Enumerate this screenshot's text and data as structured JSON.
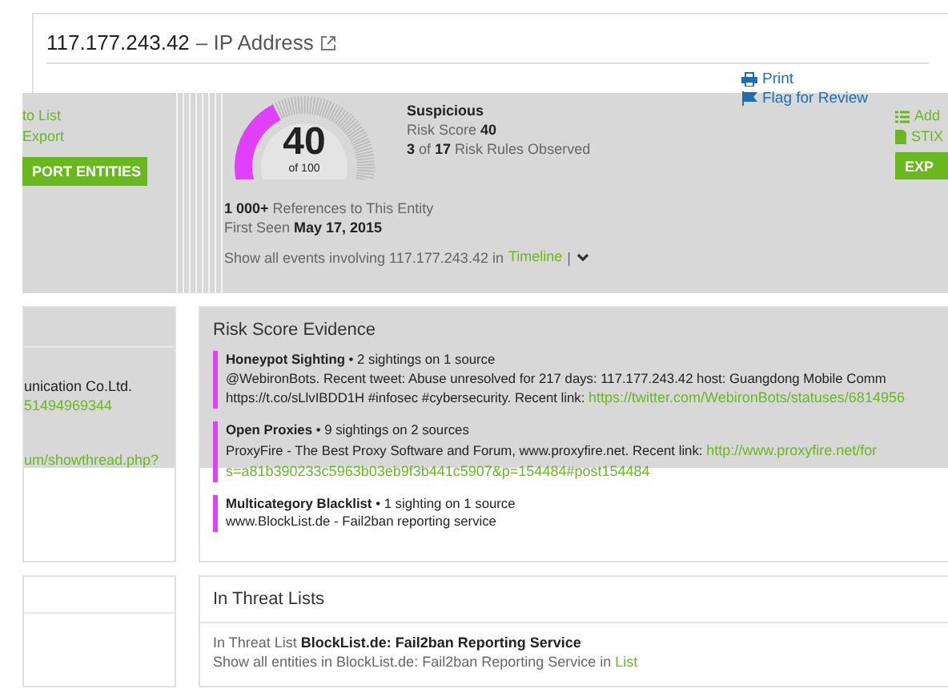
{
  "header": {
    "title": "117.177.243.42",
    "subtitle": "– IP Address",
    "actions": [
      {
        "label": "Print",
        "kind": "print"
      },
      {
        "label": "Flag for Review",
        "kind": "flag"
      }
    ]
  },
  "summary": {
    "left_links": [
      "to List",
      "Export"
    ],
    "left_button": "PORT ENTITIES",
    "gauge": {
      "score": "40",
      "of": "of 100"
    },
    "verdict": "Suspicious",
    "risk": "Risk Score **40**",
    "rules": "**3** of **17** Risk Rules Observed",
    "right_links": [
      {
        "label": "Add",
        "kind": "list"
      },
      {
        "label": "STIX",
        "kind": "file"
      }
    ],
    "right_button": "EXP",
    "references": "**1 000+** References to This Entity",
    "first_seen": "First Seen **May 17, 2015**",
    "events_text": "Show all events involving 117.177.243.42 in",
    "events_link": "Timeline",
    "separator": "|"
  },
  "left_card": {
    "lines": [
      {
        "kind": "text",
        "text": "unication Co.Ltd."
      },
      {
        "kind": "link",
        "text": "51494969344"
      },
      {
        "kind": "link",
        "text": "um/showthread.php?"
      }
    ]
  },
  "evidence": {
    "title": "Risk Score Evidence",
    "items": [
      {
        "name": "Honeypot Sighting",
        "detail": "• 2 sightings on 1 source",
        "lines": [
          {
            "text": "@WebironBots. Recent tweet: Abuse unresolved for 217 days: 117.177.243.42 host: Guangdong Mobile Comm"
          },
          {
            "text": "https://t.co/sLlvIBDD1H #infosec #cybersecurity. Recent link:",
            "link": "https://twitter.com/WebironBots/statuses/6814956"
          }
        ]
      },
      {
        "name": "Open Proxies",
        "detail": "• 9 sightings on 2 sources",
        "lines": [
          {
            "text": "ProxyFire - The Best Proxy Software and Forum, www.proxyfire.net. Recent link:",
            "link": "http://www.proxyfire.net/for"
          },
          {
            "link": "s=a81b390233c5963b03eb9f3b441c5907&p=154484#post154484"
          }
        ]
      },
      {
        "name": "Multicategory Blacklist",
        "detail": "• 1 sighting on 1 source",
        "lines": [
          {
            "text": "www.BlockList.de - Fail2ban reporting service"
          }
        ]
      }
    ]
  },
  "threat_lists": {
    "title": "In Threat Lists",
    "entry": "In Threat List **BlockList.de: Fail2ban Reporting Service**",
    "show_text": "Show all entities in BlockList.de: Fail2ban Reporting Service in",
    "show_link": "List"
  }
}
